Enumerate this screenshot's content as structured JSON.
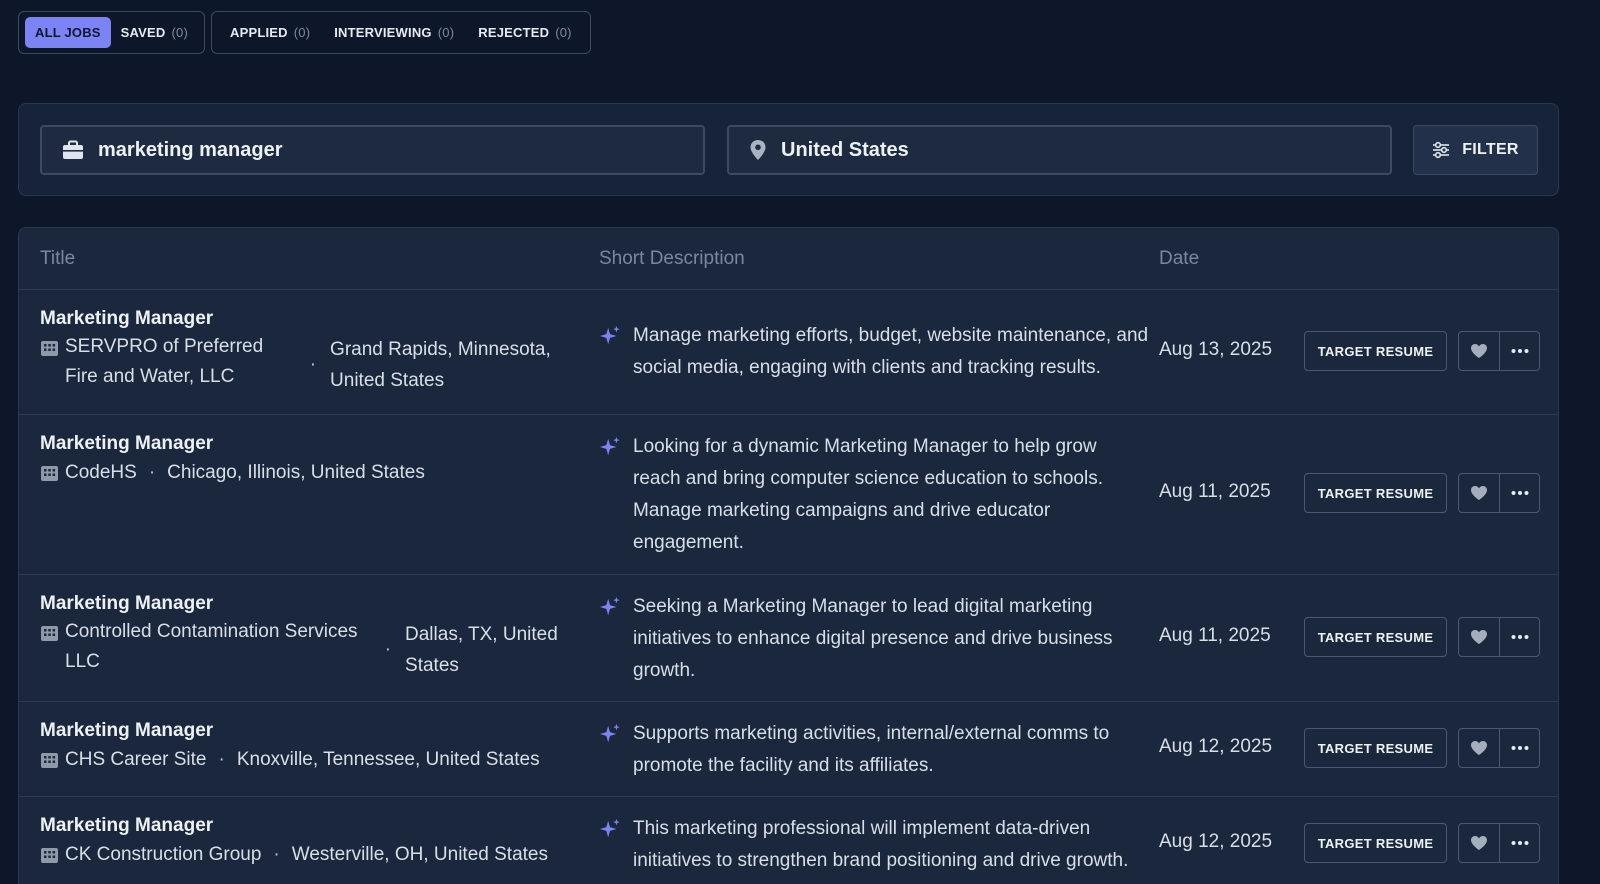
{
  "tabs": {
    "group1": [
      {
        "label": "ALL JOBS",
        "count": "",
        "active": true
      },
      {
        "label": "SAVED",
        "count": "(0)"
      }
    ],
    "group2": [
      {
        "label": "APPLIED",
        "count": "(0)"
      },
      {
        "label": "INTERVIEWING",
        "count": "(0)"
      },
      {
        "label": "REJECTED",
        "count": "(0)"
      }
    ]
  },
  "search": {
    "query": "marketing manager",
    "location": "United States",
    "filter_label": "FILTER"
  },
  "table": {
    "headers": {
      "title": "Title",
      "description": "Short Description",
      "date": "Date"
    },
    "action_label": "TARGET RESUME",
    "rows": [
      {
        "title": "Marketing Manager",
        "company": "SERVPRO of Preferred Fire and Water, LLC",
        "location": "Grand Rapids, Minnesota, United States",
        "description": "Manage marketing efforts, budget, website maintenance, and social media, engaging with clients and tracking results.",
        "date": "Aug 13, 2025"
      },
      {
        "title": "Marketing Manager",
        "company": "CodeHS",
        "location": "Chicago, Illinois, United States",
        "description": "Looking for a dynamic Marketing Manager to help grow reach and bring computer science education to schools. Manage marketing campaigns and drive educator engagement.",
        "date": "Aug 11, 2025"
      },
      {
        "title": "Marketing Manager",
        "company": "Controlled Contamination Services LLC",
        "location": "Dallas, TX, United States",
        "description": "Seeking a Marketing Manager to lead digital marketing initiatives to enhance digital presence and drive business growth.",
        "date": "Aug 11, 2025"
      },
      {
        "title": "Marketing Manager",
        "company": "CHS Career Site",
        "location": "Knoxville, Tennessee, United States",
        "description": "Supports marketing activities, internal/external comms to promote the facility and its affiliates.",
        "date": "Aug 12, 2025"
      },
      {
        "title": "Marketing Manager",
        "company": "CK Construction Group",
        "location": "Westerville, OH, United States",
        "description": "This marketing professional will implement data-driven initiatives to strengthen brand positioning and drive growth.",
        "date": "Aug 12, 2025"
      }
    ]
  },
  "colors": {
    "background": "#0d1729",
    "panel": "#1b273c",
    "accent": "#7b83f5"
  }
}
